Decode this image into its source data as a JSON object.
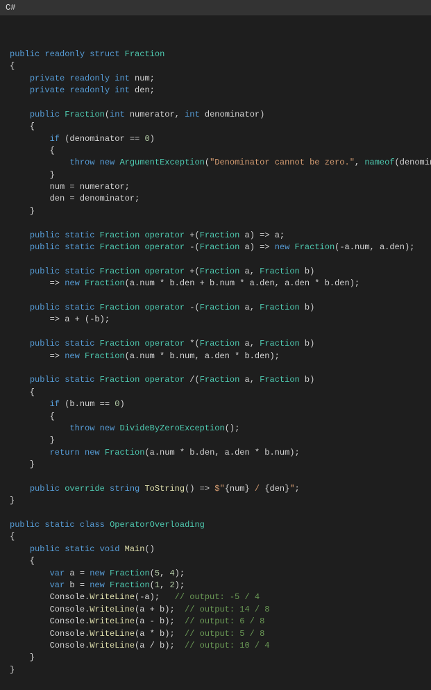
{
  "header": {
    "language": "C#"
  },
  "code": {
    "tokens": [
      [
        [
          "\n",
          "plain"
        ]
      ],
      [
        [
          "public",
          "blue"
        ],
        [
          " ",
          "plain"
        ],
        [
          "readonly",
          "blue"
        ],
        [
          " ",
          "plain"
        ],
        [
          "struct",
          "blue"
        ],
        [
          " ",
          "plain"
        ],
        [
          "Fraction",
          "teal"
        ]
      ],
      [
        [
          "{",
          "plain"
        ]
      ],
      [
        [
          "    ",
          "plain"
        ],
        [
          "private",
          "blue"
        ],
        [
          " ",
          "plain"
        ],
        [
          "readonly",
          "blue"
        ],
        [
          " ",
          "plain"
        ],
        [
          "int",
          "blue"
        ],
        [
          " num;",
          "plain"
        ]
      ],
      [
        [
          "    ",
          "plain"
        ],
        [
          "private",
          "blue"
        ],
        [
          " ",
          "plain"
        ],
        [
          "readonly",
          "blue"
        ],
        [
          " ",
          "plain"
        ],
        [
          "int",
          "blue"
        ],
        [
          " den;",
          "plain"
        ]
      ],
      [
        [
          "",
          "plain"
        ]
      ],
      [
        [
          "    ",
          "plain"
        ],
        [
          "public",
          "blue"
        ],
        [
          " ",
          "plain"
        ],
        [
          "Fraction",
          "teal"
        ],
        [
          "(",
          "plain"
        ],
        [
          "int",
          "blue"
        ],
        [
          " numerator, ",
          "plain"
        ],
        [
          "int",
          "blue"
        ],
        [
          " denominator)",
          "plain"
        ]
      ],
      [
        [
          "    {",
          "plain"
        ]
      ],
      [
        [
          "        ",
          "plain"
        ],
        [
          "if",
          "blue"
        ],
        [
          " (denominator == ",
          "plain"
        ],
        [
          "0",
          "num"
        ],
        [
          ")",
          "plain"
        ]
      ],
      [
        [
          "        {",
          "plain"
        ]
      ],
      [
        [
          "            ",
          "plain"
        ],
        [
          "throw",
          "blue"
        ],
        [
          " ",
          "plain"
        ],
        [
          "new",
          "blue"
        ],
        [
          " ",
          "plain"
        ],
        [
          "ArgumentException",
          "teal"
        ],
        [
          "(",
          "plain"
        ],
        [
          "\"Denominator cannot be zero.\"",
          "str"
        ],
        [
          ", ",
          "plain"
        ],
        [
          "nameof",
          "teal"
        ],
        [
          "(denominator));",
          "plain"
        ]
      ],
      [
        [
          "        }",
          "plain"
        ]
      ],
      [
        [
          "        num = numerator;",
          "plain"
        ]
      ],
      [
        [
          "        den = denominator;",
          "plain"
        ]
      ],
      [
        [
          "    }",
          "plain"
        ]
      ],
      [
        [
          "",
          "plain"
        ]
      ],
      [
        [
          "    ",
          "plain"
        ],
        [
          "public",
          "blue"
        ],
        [
          " ",
          "plain"
        ],
        [
          "static",
          "blue"
        ],
        [
          " ",
          "plain"
        ],
        [
          "Fraction",
          "teal"
        ],
        [
          " ",
          "plain"
        ],
        [
          "operator",
          "teal"
        ],
        [
          " +(",
          "plain"
        ],
        [
          "Fraction",
          "teal"
        ],
        [
          " a) => a;",
          "plain"
        ]
      ],
      [
        [
          "    ",
          "plain"
        ],
        [
          "public",
          "blue"
        ],
        [
          " ",
          "plain"
        ],
        [
          "static",
          "blue"
        ],
        [
          " ",
          "plain"
        ],
        [
          "Fraction",
          "teal"
        ],
        [
          " ",
          "plain"
        ],
        [
          "operator",
          "teal"
        ],
        [
          " -(",
          "plain"
        ],
        [
          "Fraction",
          "teal"
        ],
        [
          " a) => ",
          "plain"
        ],
        [
          "new",
          "blue"
        ],
        [
          " ",
          "plain"
        ],
        [
          "Fraction",
          "teal"
        ],
        [
          "(-a.num, a.den);",
          "plain"
        ]
      ],
      [
        [
          "",
          "plain"
        ]
      ],
      [
        [
          "    ",
          "plain"
        ],
        [
          "public",
          "blue"
        ],
        [
          " ",
          "plain"
        ],
        [
          "static",
          "blue"
        ],
        [
          " ",
          "plain"
        ],
        [
          "Fraction",
          "teal"
        ],
        [
          " ",
          "plain"
        ],
        [
          "operator",
          "teal"
        ],
        [
          " +(",
          "plain"
        ],
        [
          "Fraction",
          "teal"
        ],
        [
          " a, ",
          "plain"
        ],
        [
          "Fraction",
          "teal"
        ],
        [
          " b)",
          "plain"
        ]
      ],
      [
        [
          "        => ",
          "plain"
        ],
        [
          "new",
          "blue"
        ],
        [
          " ",
          "plain"
        ],
        [
          "Fraction",
          "teal"
        ],
        [
          "(a.num * b.den + b.num * a.den, a.den * b.den);",
          "plain"
        ]
      ],
      [
        [
          "",
          "plain"
        ]
      ],
      [
        [
          "    ",
          "plain"
        ],
        [
          "public",
          "blue"
        ],
        [
          " ",
          "plain"
        ],
        [
          "static",
          "blue"
        ],
        [
          " ",
          "plain"
        ],
        [
          "Fraction",
          "teal"
        ],
        [
          " ",
          "plain"
        ],
        [
          "operator",
          "teal"
        ],
        [
          " -(",
          "plain"
        ],
        [
          "Fraction",
          "teal"
        ],
        [
          " a, ",
          "plain"
        ],
        [
          "Fraction",
          "teal"
        ],
        [
          " b)",
          "plain"
        ]
      ],
      [
        [
          "        => a + (-b);",
          "plain"
        ]
      ],
      [
        [
          "",
          "plain"
        ]
      ],
      [
        [
          "    ",
          "plain"
        ],
        [
          "public",
          "blue"
        ],
        [
          " ",
          "plain"
        ],
        [
          "static",
          "blue"
        ],
        [
          " ",
          "plain"
        ],
        [
          "Fraction",
          "teal"
        ],
        [
          " ",
          "plain"
        ],
        [
          "operator",
          "teal"
        ],
        [
          " *(",
          "plain"
        ],
        [
          "Fraction",
          "teal"
        ],
        [
          " a, ",
          "plain"
        ],
        [
          "Fraction",
          "teal"
        ],
        [
          " b)",
          "plain"
        ]
      ],
      [
        [
          "        => ",
          "plain"
        ],
        [
          "new",
          "blue"
        ],
        [
          " ",
          "plain"
        ],
        [
          "Fraction",
          "teal"
        ],
        [
          "(a.num * b.num, a.den * b.den);",
          "plain"
        ]
      ],
      [
        [
          "",
          "plain"
        ]
      ],
      [
        [
          "    ",
          "plain"
        ],
        [
          "public",
          "blue"
        ],
        [
          " ",
          "plain"
        ],
        [
          "static",
          "blue"
        ],
        [
          " ",
          "plain"
        ],
        [
          "Fraction",
          "teal"
        ],
        [
          " ",
          "plain"
        ],
        [
          "operator",
          "teal"
        ],
        [
          " /(",
          "plain"
        ],
        [
          "Fraction",
          "teal"
        ],
        [
          " a, ",
          "plain"
        ],
        [
          "Fraction",
          "teal"
        ],
        [
          " b)",
          "plain"
        ]
      ],
      [
        [
          "    {",
          "plain"
        ]
      ],
      [
        [
          "        ",
          "plain"
        ],
        [
          "if",
          "blue"
        ],
        [
          " (b.num == ",
          "plain"
        ],
        [
          "0",
          "num"
        ],
        [
          ")",
          "plain"
        ]
      ],
      [
        [
          "        {",
          "plain"
        ]
      ],
      [
        [
          "            ",
          "plain"
        ],
        [
          "throw",
          "blue"
        ],
        [
          " ",
          "plain"
        ],
        [
          "new",
          "blue"
        ],
        [
          " ",
          "plain"
        ],
        [
          "DivideByZeroException",
          "teal"
        ],
        [
          "();",
          "plain"
        ]
      ],
      [
        [
          "        }",
          "plain"
        ]
      ],
      [
        [
          "        ",
          "plain"
        ],
        [
          "return",
          "blue"
        ],
        [
          " ",
          "plain"
        ],
        [
          "new",
          "blue"
        ],
        [
          " ",
          "plain"
        ],
        [
          "Fraction",
          "teal"
        ],
        [
          "(a.num * b.den, a.den * b.num);",
          "plain"
        ]
      ],
      [
        [
          "    }",
          "plain"
        ]
      ],
      [
        [
          "",
          "plain"
        ]
      ],
      [
        [
          "    ",
          "plain"
        ],
        [
          "public",
          "blue"
        ],
        [
          " ",
          "plain"
        ],
        [
          "override",
          "teal"
        ],
        [
          " ",
          "plain"
        ],
        [
          "string",
          "blue"
        ],
        [
          " ",
          "plain"
        ],
        [
          "ToString",
          "yellow"
        ],
        [
          "() => ",
          "plain"
        ],
        [
          "$\"",
          "str"
        ],
        [
          "{num}",
          "plain"
        ],
        [
          " / ",
          "str"
        ],
        [
          "{den}",
          "plain"
        ],
        [
          "\"",
          "str"
        ],
        [
          ";",
          "plain"
        ]
      ],
      [
        [
          "}",
          "plain"
        ]
      ],
      [
        [
          "",
          "plain"
        ]
      ],
      [
        [
          "public",
          "blue"
        ],
        [
          " ",
          "plain"
        ],
        [
          "static",
          "blue"
        ],
        [
          " ",
          "plain"
        ],
        [
          "class",
          "blue"
        ],
        [
          " ",
          "plain"
        ],
        [
          "OperatorOverloading",
          "teal"
        ]
      ],
      [
        [
          "{",
          "plain"
        ]
      ],
      [
        [
          "    ",
          "plain"
        ],
        [
          "public",
          "blue"
        ],
        [
          " ",
          "plain"
        ],
        [
          "static",
          "blue"
        ],
        [
          " ",
          "plain"
        ],
        [
          "void",
          "blue"
        ],
        [
          " ",
          "plain"
        ],
        [
          "Main",
          "yellow"
        ],
        [
          "()",
          "plain"
        ]
      ],
      [
        [
          "    {",
          "plain"
        ]
      ],
      [
        [
          "        ",
          "plain"
        ],
        [
          "var",
          "blue"
        ],
        [
          " a = ",
          "plain"
        ],
        [
          "new",
          "blue"
        ],
        [
          " ",
          "plain"
        ],
        [
          "Fraction",
          "teal"
        ],
        [
          "(",
          "plain"
        ],
        [
          "5",
          "num"
        ],
        [
          ", ",
          "plain"
        ],
        [
          "4",
          "num"
        ],
        [
          ");",
          "plain"
        ]
      ],
      [
        [
          "        ",
          "plain"
        ],
        [
          "var",
          "blue"
        ],
        [
          " b = ",
          "plain"
        ],
        [
          "new",
          "blue"
        ],
        [
          " ",
          "plain"
        ],
        [
          "Fraction",
          "teal"
        ],
        [
          "(",
          "plain"
        ],
        [
          "1",
          "num"
        ],
        [
          ", ",
          "plain"
        ],
        [
          "2",
          "num"
        ],
        [
          ");",
          "plain"
        ]
      ],
      [
        [
          "        Console.",
          "plain"
        ],
        [
          "WriteLine",
          "yellow"
        ],
        [
          "(-a);   ",
          "plain"
        ],
        [
          "// output: -5 / 4",
          "cmt"
        ]
      ],
      [
        [
          "        Console.",
          "plain"
        ],
        [
          "WriteLine",
          "yellow"
        ],
        [
          "(a + b);  ",
          "plain"
        ],
        [
          "// output: 14 / 8",
          "cmt"
        ]
      ],
      [
        [
          "        Console.",
          "plain"
        ],
        [
          "WriteLine",
          "yellow"
        ],
        [
          "(a - b);  ",
          "plain"
        ],
        [
          "// output: 6 / 8",
          "cmt"
        ]
      ],
      [
        [
          "        Console.",
          "plain"
        ],
        [
          "WriteLine",
          "yellow"
        ],
        [
          "(a * b);  ",
          "plain"
        ],
        [
          "// output: 5 / 8",
          "cmt"
        ]
      ],
      [
        [
          "        Console.",
          "plain"
        ],
        [
          "WriteLine",
          "yellow"
        ],
        [
          "(a / b);  ",
          "plain"
        ],
        [
          "// output: 10 / 4",
          "cmt"
        ]
      ],
      [
        [
          "    }",
          "plain"
        ]
      ],
      [
        [
          "}",
          "plain"
        ]
      ]
    ]
  }
}
